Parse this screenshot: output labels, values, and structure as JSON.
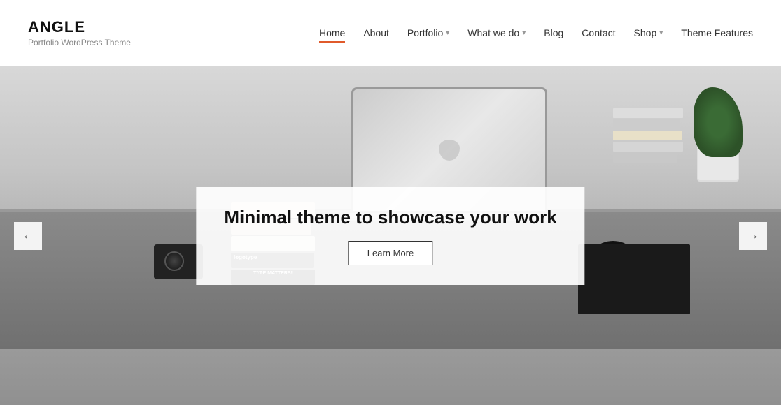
{
  "header": {
    "logo": {
      "title": "ANGLE",
      "subtitle": "Portfolio WordPress Theme"
    },
    "nav": {
      "items": [
        {
          "id": "home",
          "label": "Home",
          "active": true,
          "hasDropdown": false
        },
        {
          "id": "about",
          "label": "About",
          "active": false,
          "hasDropdown": false
        },
        {
          "id": "portfolio",
          "label": "Portfolio",
          "active": false,
          "hasDropdown": true
        },
        {
          "id": "what-we-do",
          "label": "What we do",
          "active": false,
          "hasDropdown": true
        },
        {
          "id": "blog",
          "label": "Blog",
          "active": false,
          "hasDropdown": false
        },
        {
          "id": "contact",
          "label": "Contact",
          "active": false,
          "hasDropdown": false
        },
        {
          "id": "shop",
          "label": "Shop",
          "active": false,
          "hasDropdown": true
        },
        {
          "id": "theme-features",
          "label": "Theme Features",
          "active": false,
          "hasDropdown": false
        }
      ]
    }
  },
  "hero": {
    "title": "Minimal theme to showcase your work",
    "cta_label": "Learn More",
    "prev_arrow": "←",
    "next_arrow": "→"
  },
  "colors": {
    "accent": "#e05a2b",
    "nav_active_underline": "#e05a2b"
  }
}
